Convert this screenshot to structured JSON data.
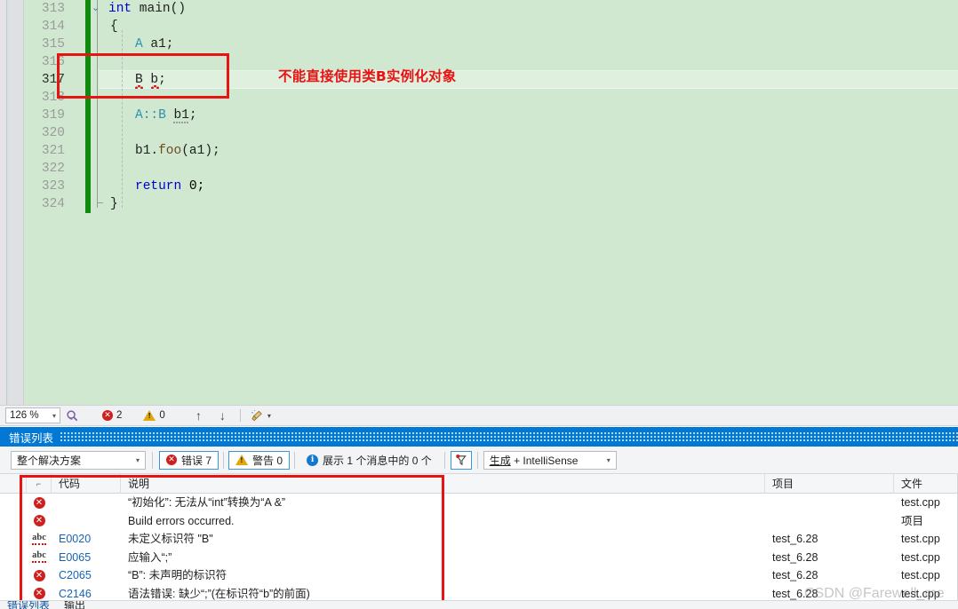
{
  "editor": {
    "lines": [
      {
        "num": "313",
        "segments": [
          {
            "t": "int",
            "c": "kw"
          },
          {
            "t": " main()",
            "c": "plain"
          }
        ]
      },
      {
        "num": "314",
        "segments": [
          {
            "t": "{",
            "c": "plain"
          }
        ]
      },
      {
        "num": "315",
        "segments": [
          {
            "t": "    A a1;",
            "c": "type-lead"
          }
        ]
      },
      {
        "num": "316",
        "segments": []
      },
      {
        "num": "317",
        "segments": [
          {
            "t": "    B b;",
            "c": "plain"
          }
        ]
      },
      {
        "num": "318",
        "segments": []
      },
      {
        "num": "319",
        "segments": [
          {
            "t": "    A::B b1;",
            "c": "type-lead"
          }
        ]
      },
      {
        "num": "320",
        "segments": []
      },
      {
        "num": "321",
        "segments": [
          {
            "t": "    b1.foo(a1);",
            "c": "fn"
          }
        ]
      },
      {
        "num": "322",
        "segments": []
      },
      {
        "num": "323",
        "segments": [
          {
            "t": "    return 0;",
            "c": "kw"
          }
        ]
      },
      {
        "num": "324",
        "segments": [
          {
            "t": "}",
            "c": "plain"
          }
        ]
      }
    ],
    "code": {
      "l313_kw": "int",
      "l313_rest": " main()",
      "l314": "{",
      "l315_type": "A",
      "l315_rest": " a1;",
      "l317": "B b;",
      "l319_type": "A::B",
      "l319_rest": " b1;",
      "l321": "b1.",
      "l321_fn": "foo",
      "l321_tail": "(a1);",
      "l323_kw": "return",
      "l323_num": " 0;",
      "l324": "}"
    },
    "annotation": "不能直接使用类B实例化对象",
    "collapse_glyph": "⌄"
  },
  "status_bar": {
    "zoom_value": "126 %",
    "zoom_caret": "▾",
    "magnifier_icon": "magnifier-icon",
    "error_count": "2",
    "warning_count": "0",
    "up_arrow": "↑",
    "down_arrow": "↓",
    "brush_icon": "brush-icon",
    "brush_caret": "▾"
  },
  "panel": {
    "title": "错误列表",
    "toolbar": {
      "scope_value": "整个解决方案",
      "scope_caret": "▾",
      "errors_label": "错误 7",
      "warnings_label": "警告 0",
      "messages_label": "展示 1 个消息中的 0 个",
      "filter_icon": "filter-icon",
      "build_value_underlined": "生成",
      "build_value_rest": " + IntelliSense",
      "build_caret": "▾"
    },
    "columns": {
      "select": "",
      "icon": "⌐",
      "code": "代码",
      "description": "说明",
      "project": "项目",
      "file": "文件"
    },
    "rows": [
      {
        "icon": "error",
        "code": "",
        "description": "“初始化”: 无法从“int”转换为“A &”",
        "project": "",
        "file": "test.cpp"
      },
      {
        "icon": "error",
        "code": "",
        "description": "Build errors occurred.",
        "project": "",
        "file": "项目"
      },
      {
        "icon": "abc",
        "code": "E0020",
        "description": "未定义标识符 \"B\"",
        "project": "test_6.28",
        "file": "test.cpp"
      },
      {
        "icon": "abc",
        "code": "E0065",
        "description": "应输入“;”",
        "project": "test_6.28",
        "file": "test.cpp"
      },
      {
        "icon": "error",
        "code": "C2065",
        "description": "“B”: 未声明的标识符",
        "project": "test_6.28",
        "file": "test.cpp"
      },
      {
        "icon": "error",
        "code": "C2146",
        "description": "语法错误: 缺少“;”(在标识符“b”的前面)",
        "project": "test_6.28",
        "file": "test.cpp"
      }
    ],
    "bottom_tabs": [
      {
        "label": "错误列表",
        "active": true
      },
      {
        "label": "输出",
        "active": false
      }
    ]
  },
  "watermark": "CSDN @Farewell_me",
  "colors": {
    "editor_background": "#cfe8cf",
    "change_bar_green": "#108b10",
    "annotation_red": "#e81313",
    "panel_title_blue": "#0078d4",
    "error_red": "#cf2020",
    "warning_amber": "#e0a80d",
    "info_blue": "#1379d0",
    "code_link_blue": "#1663b5",
    "keyword_blue": "#0000d6",
    "type_teal": "#2b91af"
  }
}
